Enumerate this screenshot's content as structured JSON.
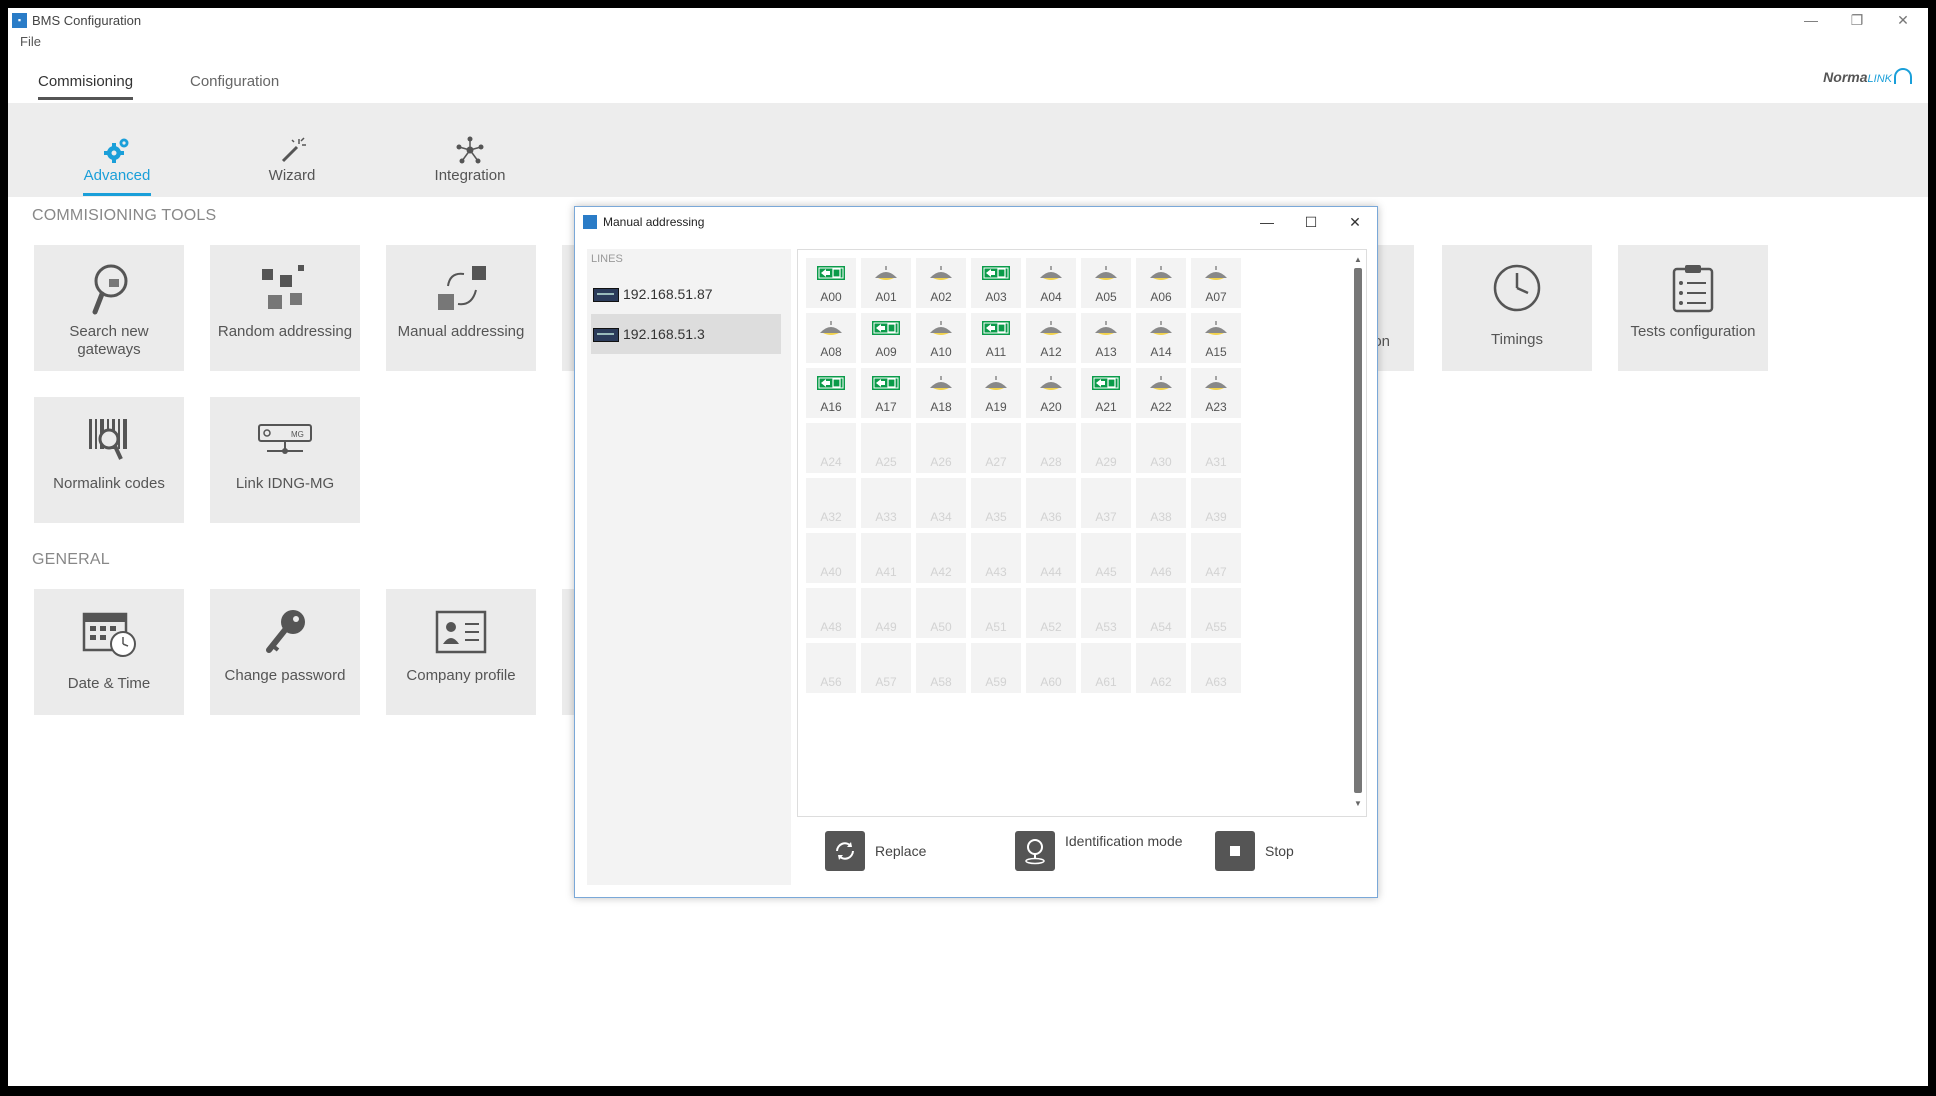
{
  "app": {
    "title": "BMS Configuration",
    "icon": "app-icon"
  },
  "window_controls": {
    "minimize": "—",
    "restore": "❐",
    "close": "✕"
  },
  "menu": {
    "file": "File"
  },
  "tabs": [
    {
      "label": "Commisioning",
      "active": true
    },
    {
      "label": "Configuration",
      "active": false
    }
  ],
  "brand": {
    "name": "Norma",
    "suffix": "LINK"
  },
  "ribbon": [
    {
      "label": "Advanced",
      "icon": "gears-icon",
      "active": true
    },
    {
      "label": "Wizard",
      "icon": "magic-wand-icon",
      "active": false
    },
    {
      "label": "Integration",
      "icon": "network-icon",
      "active": false
    }
  ],
  "sections": {
    "tools": "COMMISIONING TOOLS",
    "general": "GENERAL"
  },
  "tools": {
    "search_gateways": "Search new gateways",
    "random_addressing": "Random addressing",
    "manual_addressing": "Manual addressing",
    "normalink_codes": "Normalink codes",
    "link_idng": "Link IDNG-MG",
    "partial_hidden": "ion",
    "timings": "Timings",
    "tests_configuration": "Tests configuration"
  },
  "general": {
    "date_time": "Date & Time",
    "change_password": "Change password",
    "company_profile": "Company profile"
  },
  "dialog": {
    "title": "Manual addressing",
    "controls": {
      "minimize": "—",
      "maximize": "☐",
      "close": "✕"
    },
    "lines_header": "LINES",
    "lines": [
      {
        "ip": "192.168.51.87"
      },
      {
        "ip": "192.168.51.3"
      }
    ],
    "selected_line": 1,
    "addresses": [
      {
        "label": "A00",
        "type": "exit"
      },
      {
        "label": "A01",
        "type": "lamp"
      },
      {
        "label": "A02",
        "type": "lamp"
      },
      {
        "label": "A03",
        "type": "exit"
      },
      {
        "label": "A04",
        "type": "lamp"
      },
      {
        "label": "A05",
        "type": "lamp"
      },
      {
        "label": "A06",
        "type": "lamp"
      },
      {
        "label": "A07",
        "type": "lamp"
      },
      {
        "label": "A08",
        "type": "lamp"
      },
      {
        "label": "A09",
        "type": "exit"
      },
      {
        "label": "A10",
        "type": "lamp"
      },
      {
        "label": "A11",
        "type": "exit"
      },
      {
        "label": "A12",
        "type": "lamp"
      },
      {
        "label": "A13",
        "type": "lamp"
      },
      {
        "label": "A14",
        "type": "lamp"
      },
      {
        "label": "A15",
        "type": "lamp"
      },
      {
        "label": "A16",
        "type": "exit"
      },
      {
        "label": "A17",
        "type": "exit"
      },
      {
        "label": "A18",
        "type": "lamp"
      },
      {
        "label": "A19",
        "type": "lamp"
      },
      {
        "label": "A20",
        "type": "lamp"
      },
      {
        "label": "A21",
        "type": "exit"
      },
      {
        "label": "A22",
        "type": "lamp"
      },
      {
        "label": "A23",
        "type": "lamp"
      },
      {
        "label": "A24",
        "type": "empty"
      },
      {
        "label": "A25",
        "type": "empty"
      },
      {
        "label": "A26",
        "type": "empty"
      },
      {
        "label": "A27",
        "type": "empty"
      },
      {
        "label": "A28",
        "type": "empty"
      },
      {
        "label": "A29",
        "type": "empty"
      },
      {
        "label": "A30",
        "type": "empty"
      },
      {
        "label": "A31",
        "type": "empty"
      },
      {
        "label": "A32",
        "type": "empty"
      },
      {
        "label": "A33",
        "type": "empty"
      },
      {
        "label": "A34",
        "type": "empty"
      },
      {
        "label": "A35",
        "type": "empty"
      },
      {
        "label": "A36",
        "type": "empty"
      },
      {
        "label": "A37",
        "type": "empty"
      },
      {
        "label": "A38",
        "type": "empty"
      },
      {
        "label": "A39",
        "type": "empty"
      },
      {
        "label": "A40",
        "type": "empty"
      },
      {
        "label": "A41",
        "type": "empty"
      },
      {
        "label": "A42",
        "type": "empty"
      },
      {
        "label": "A43",
        "type": "empty"
      },
      {
        "label": "A44",
        "type": "empty"
      },
      {
        "label": "A45",
        "type": "empty"
      },
      {
        "label": "A46",
        "type": "empty"
      },
      {
        "label": "A47",
        "type": "empty"
      },
      {
        "label": "A48",
        "type": "empty"
      },
      {
        "label": "A49",
        "type": "empty"
      },
      {
        "label": "A50",
        "type": "empty"
      },
      {
        "label": "A51",
        "type": "empty"
      },
      {
        "label": "A52",
        "type": "empty"
      },
      {
        "label": "A53",
        "type": "empty"
      },
      {
        "label": "A54",
        "type": "empty"
      },
      {
        "label": "A55",
        "type": "empty"
      },
      {
        "label": "A56",
        "type": "empty"
      },
      {
        "label": "A57",
        "type": "empty"
      },
      {
        "label": "A58",
        "type": "empty"
      },
      {
        "label": "A59",
        "type": "empty"
      },
      {
        "label": "A60",
        "type": "empty"
      },
      {
        "label": "A61",
        "type": "empty"
      },
      {
        "label": "A62",
        "type": "empty"
      },
      {
        "label": "A63",
        "type": "empty"
      }
    ],
    "actions": {
      "replace": "Replace",
      "identification": "Identification mode",
      "stop": "Stop"
    }
  },
  "colors": {
    "accent": "#1a9fd9",
    "exit_sign": "#0a9b49",
    "lamp": "#888888",
    "lamp_light": "#f2d24b"
  }
}
